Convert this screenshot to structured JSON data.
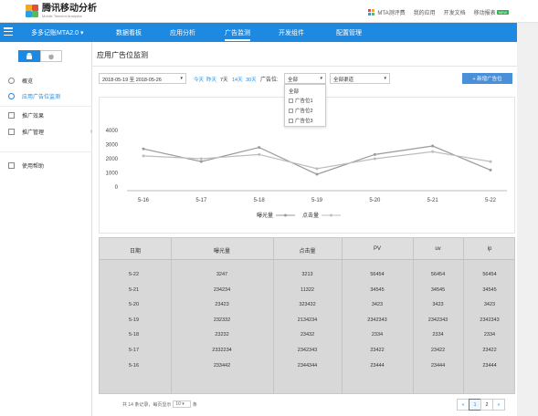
{
  "header": {
    "logo_title": "腾讯移动分析",
    "logo_subtitle": "Mobile Tencent Analytics",
    "links": [
      {
        "label": "MTA测评费"
      },
      {
        "label": "我的应用"
      },
      {
        "label": "开发文档"
      },
      {
        "label": "移动报表"
      }
    ],
    "new_badge": "NEW"
  },
  "nav": {
    "app_selector": "多多记账MTA2.0",
    "items": [
      {
        "label": "数据看板"
      },
      {
        "label": "应用分析"
      },
      {
        "label": "广告监测"
      },
      {
        "label": "开发组件"
      },
      {
        "label": "配置管理"
      }
    ],
    "active_index": 2
  },
  "sidebar": {
    "items": [
      {
        "label": "概览"
      },
      {
        "label": "应用广告位监测"
      },
      {
        "label": "推广效果"
      },
      {
        "label": "推广管理"
      },
      {
        "label": "使用帮助"
      }
    ],
    "active_index": 1
  },
  "page": {
    "title": "应用广告位监测",
    "date_range": "2018-05-19 至 2018-05-26",
    "quick_ranges": [
      "今天",
      "昨天",
      "7天",
      "14天",
      "30天"
    ],
    "current_quick": "7天",
    "position_label": "广告位:",
    "position_select": "全部",
    "channel_select": "全部渠道",
    "add_button": "+ 新增广告位",
    "dropdown_options": [
      "全部",
      "广告位1",
      "广告位2",
      "广告位3"
    ]
  },
  "chart_data": {
    "type": "line",
    "x": [
      "5-16",
      "5-17",
      "5-18",
      "5-19",
      "5-20",
      "5-21",
      "5-22"
    ],
    "ylim": [
      0,
      4000
    ],
    "yticks": [
      0,
      1000,
      2000,
      3000,
      4000
    ],
    "ytick_labels": [
      "0",
      "1000",
      "2000",
      "3000",
      "4000"
    ],
    "series": [
      {
        "name": "曝光量",
        "values": [
          2700,
          1800,
          2800,
          900,
          2300,
          2900,
          1200
        ]
      },
      {
        "name": "点击量",
        "values": [
          2200,
          2000,
          2300,
          1300,
          2000,
          2500,
          1800
        ]
      }
    ],
    "legend_position": "bottom",
    "colors": {
      "exposure": "#9a9a9a",
      "click": "#bdbdbd"
    }
  },
  "table": {
    "columns": [
      "日期",
      "曝光量",
      "点击量",
      "PV",
      "uv",
      "ip"
    ],
    "rows": [
      [
        "5-22",
        "3247",
        "3213",
        "56454",
        "56454",
        "56454"
      ],
      [
        "5-21",
        "234234",
        "11322",
        "34545",
        "34545",
        "34545"
      ],
      [
        "5-20",
        "23423",
        "323432",
        "3423",
        "3423",
        "3423"
      ],
      [
        "5-19",
        "232332",
        "2134234",
        "2342343",
        "2342343",
        "2342343"
      ],
      [
        "5-18",
        "23232",
        "23432",
        "2334",
        "2334",
        "2334"
      ],
      [
        "5-17",
        "2332234",
        "2342343",
        "23422",
        "23422",
        "23422"
      ],
      [
        "5-16",
        "233442",
        "2344344",
        "23444",
        "23444",
        "23444"
      ]
    ]
  },
  "pagination": {
    "info_prefix": "共 14 条记录，每页显示",
    "page_size": "10",
    "info_suffix": "条",
    "pages": [
      "1",
      "2"
    ],
    "current_page": "1"
  },
  "colors": {
    "primary": "#1e89e0",
    "table_bg": "#d8d8d8",
    "badge_green": "#2bb24c"
  }
}
